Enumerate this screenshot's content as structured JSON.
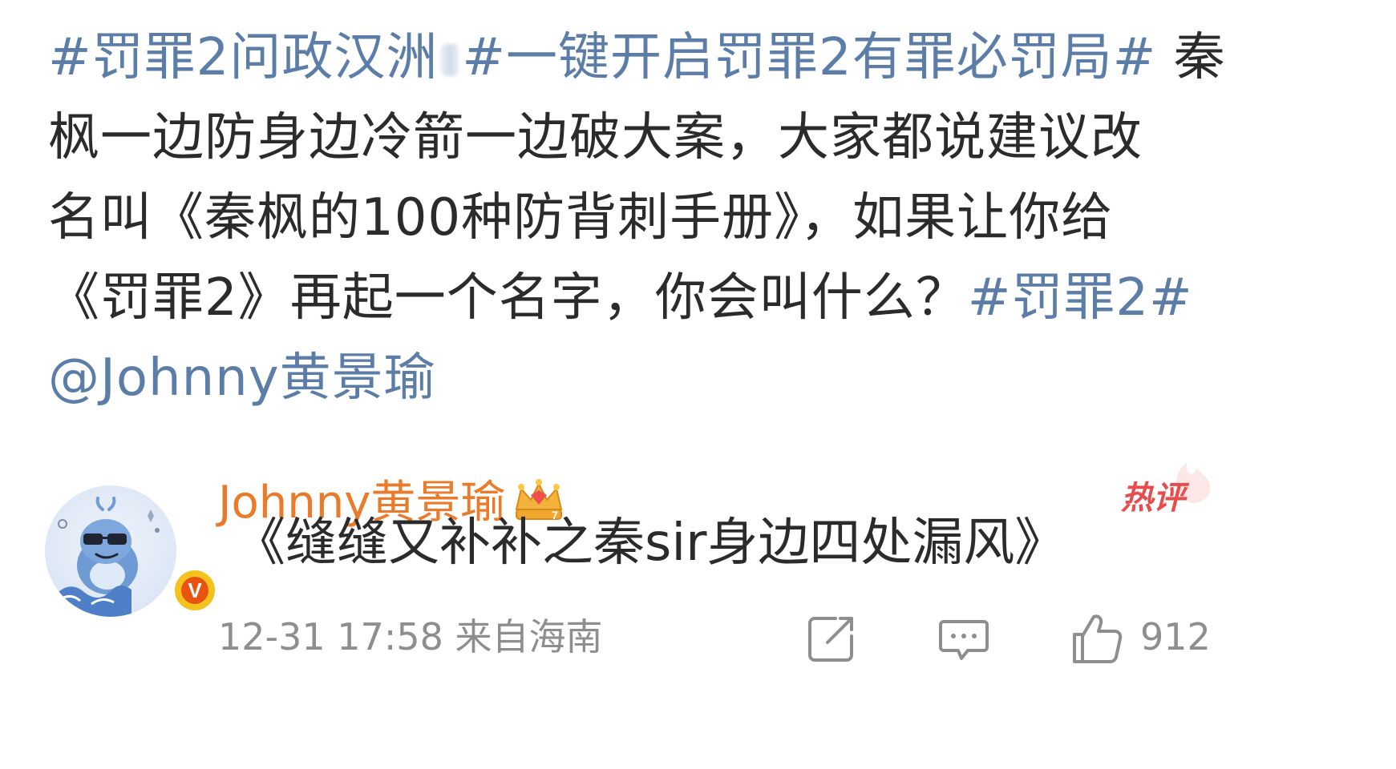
{
  "post": {
    "lines": [
      {
        "tag1": "#罚罪2问政汉洲",
        "tag2": "#一键开启罚罪2有罪必罚局#",
        "text": " 秦"
      },
      {
        "text": "枫一边防身边冷箭一边破大案，大家都说建议改"
      },
      {
        "text": "名叫《秦枫的100种防背刺手册》，如果让你给"
      },
      {
        "text": "《罚罪2》再起一个名字，你会叫什么？",
        "tag": "#罚罪2#"
      },
      {
        "mention": "@Johnny黄景瑜"
      }
    ]
  },
  "comment": {
    "username": "Johnny黄景瑜",
    "hot_label": "热评",
    "text": "《缝缝又补补之秦sir身边四处漏风》",
    "verified_label": "V",
    "time": "12-31 17:58",
    "location": "来自海南",
    "like_count": "912"
  },
  "icons": {
    "avatar": "cartoon-dolphin-avatar",
    "verified": "verified-badge-icon",
    "crown": "crown-member-icon",
    "share": "share-icon",
    "comment": "comment-icon",
    "like": "thumbs-up-icon"
  },
  "colors": {
    "link": "#5b7da8",
    "username": "#e97b2b",
    "hot": "#e94c4c",
    "meta": "#8e8e8e",
    "text": "#2b2b2b"
  }
}
